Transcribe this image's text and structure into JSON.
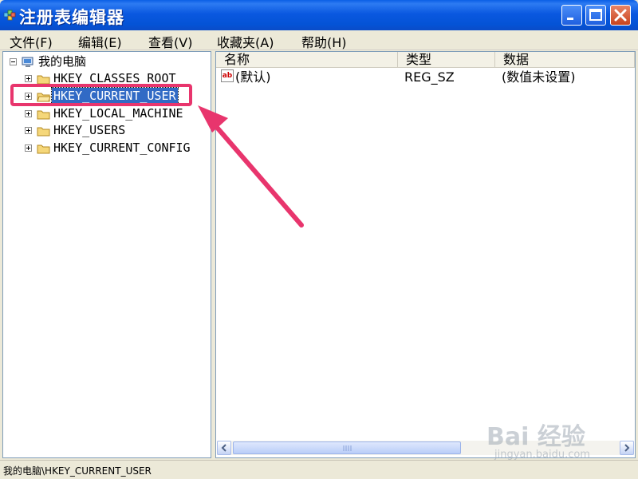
{
  "window": {
    "title": "注册表编辑器"
  },
  "menu": [
    "文件(F)",
    "编辑(E)",
    "查看(V)",
    "收藏夹(A)",
    "帮助(H)"
  ],
  "tree": {
    "root": "我的电脑",
    "keys": [
      "HKEY_CLASSES_ROOT",
      "HKEY_CURRENT_USER",
      "HKEY_LOCAL_MACHINE",
      "HKEY_USERS",
      "HKEY_CURRENT_CONFIG"
    ],
    "selected_key": "HKEY_CURRENT_USER"
  },
  "list": {
    "columns": [
      "名称",
      "类型",
      "数据"
    ],
    "rows": [
      {
        "name": "(默认)",
        "type": "REG_SZ",
        "data": "(数值未设置)"
      }
    ]
  },
  "status": {
    "path": "我的电脑\\HKEY_CURRENT_USER"
  },
  "watermark": {
    "text": "Bai 经验",
    "sub": "jingyan.baidu.com"
  },
  "colors": {
    "titlebar": "#0a58e0",
    "selection": "#316ac5",
    "highlight": "#e8356d"
  }
}
